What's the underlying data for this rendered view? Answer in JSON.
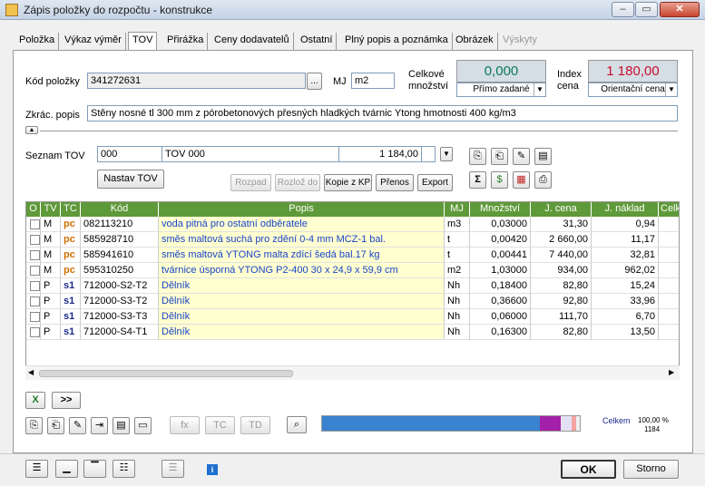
{
  "window": {
    "title": "Zápis položky do rozpočtu - konstrukce"
  },
  "tabs": [
    {
      "label": "Položka",
      "active": false,
      "disabled": false
    },
    {
      "label": "Výkaz výměr",
      "active": false,
      "disabled": false
    },
    {
      "label": "TOV",
      "active": true,
      "disabled": false
    },
    {
      "label": "Přirážka",
      "active": false,
      "disabled": false
    },
    {
      "label": "Ceny dodavatelů",
      "active": false,
      "disabled": false
    },
    {
      "label": "Ostatní",
      "active": false,
      "disabled": false
    },
    {
      "label": "Plný popis a poznámka",
      "active": false,
      "disabled": false
    },
    {
      "label": "Obrázek",
      "active": false,
      "disabled": false
    },
    {
      "label": "Výskyty",
      "active": false,
      "disabled": true
    }
  ],
  "form": {
    "kod_label": "Kód položky",
    "kod_value": "341272631",
    "browse": "...",
    "mj_label": "MJ",
    "mj_value": "m2",
    "celkove_label": "Celkové množství",
    "celkove_value": "0,000",
    "celkove_mode": "Přímo zadané",
    "index_label": "Index cena",
    "index_value": "1 180,00",
    "index_mode": "Orientační cena",
    "zkrac_label": "Zkrác. popis",
    "zkrac_value": "Stěny nosné tl 300 mm z pórobetonových přesných hladkých tvárnic Ytong hmotnosti 400 kg/m3",
    "seznam_label": "Seznam TOV",
    "seznam_code": "000",
    "seznam_name": "TOV 000",
    "seznam_value": "1 184,00",
    "nastav_button": "Nastav TOV"
  },
  "actions": [
    "Rozpad",
    "Rozlož do",
    "Kopie z KP",
    "Přenos",
    "Export"
  ],
  "actions_disabled": [
    true,
    true,
    false,
    false,
    false
  ],
  "grid": {
    "columns": [
      "O",
      "TV",
      "TC",
      "Kód",
      "Popis",
      "MJ",
      "Množství",
      "J. cena",
      "J. náklad",
      "Celk"
    ],
    "rows": [
      {
        "tv": "M",
        "tc": "pc",
        "kod": "082113210",
        "popis": "voda pitná pro ostatní odběratele",
        "mj": "m3",
        "mnozstvi": "0,03000",
        "jcena": "31,30",
        "jnaklad": "0,94"
      },
      {
        "tv": "M",
        "tc": "pc",
        "kod": "585928710",
        "popis": "směs maltová suchá pro zdění 0-4 mm MCZ-1 bal.",
        "mj": "t",
        "mnozstvi": "0,00420",
        "jcena": "2 660,00",
        "jnaklad": "11,17"
      },
      {
        "tv": "M",
        "tc": "pc",
        "kod": "585941610",
        "popis": "směs maltová YTONG malta zdící šedá bal.17 kg",
        "mj": "t",
        "mnozstvi": "0,00441",
        "jcena": "7 440,00",
        "jnaklad": "32,81"
      },
      {
        "tv": "M",
        "tc": "pc",
        "kod": "595310250",
        "popis": "tvárnice úsporná YTONG P2-400 30 x 24,9 x 59,9 cm",
        "mj": "m2",
        "mnozstvi": "1,03000",
        "jcena": "934,00",
        "jnaklad": "962,02"
      },
      {
        "tv": "P",
        "tc": "s1",
        "kod": "712000-S2-T2",
        "popis": "Dělník",
        "mj": "Nh",
        "mnozstvi": "0,18400",
        "jcena": "82,80",
        "jnaklad": "15,24"
      },
      {
        "tv": "P",
        "tc": "s1",
        "kod": "712000-S3-T2",
        "popis": "Dělník",
        "mj": "Nh",
        "mnozstvi": "0,36600",
        "jcena": "92,80",
        "jnaklad": "33,96"
      },
      {
        "tv": "P",
        "tc": "s1",
        "kod": "712000-S3-T3",
        "popis": "Dělník",
        "mj": "Nh",
        "mnozstvi": "0,06000",
        "jcena": "111,70",
        "jnaklad": "6,70"
      },
      {
        "tv": "P",
        "tc": "s1",
        "kod": "712000-S4-T1",
        "popis": "Dělník",
        "mj": "Nh",
        "mnozstvi": "0,16300",
        "jcena": "82,80",
        "jnaklad": "13,50"
      }
    ]
  },
  "bottom": {
    "more_button": ">>",
    "fx": "fx",
    "tc": "TC",
    "td": "TD",
    "celkem_label": "Celkem",
    "celkem_percent": "100,00 %",
    "celkem_value": "1184",
    "progress_segments": [
      {
        "fraction": 0.845,
        "color": "#3a83d0"
      },
      {
        "fraction": 0.08,
        "color": "#a321a8"
      },
      {
        "fraction": 0.045,
        "color": "#e5e1f5"
      },
      {
        "fraction": 0.015,
        "color": "#f4a3a3"
      }
    ]
  },
  "footer": {
    "ok": "OK",
    "storno": "Storno",
    "info": "i"
  },
  "colors": {
    "tc_pc": "#d07000",
    "tc_s1": "#1b2a8c",
    "celkove_value": "#0a7a55",
    "index_value": "#c8102e"
  }
}
